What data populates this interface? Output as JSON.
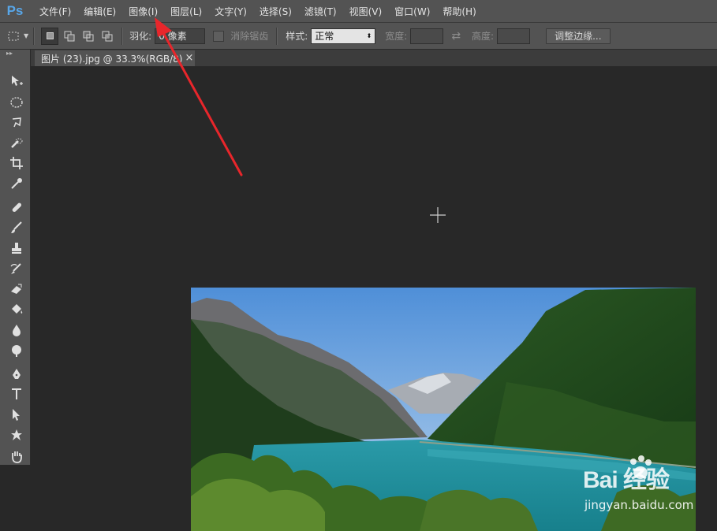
{
  "app": {
    "logo": "Ps"
  },
  "menu": [
    "文件(F)",
    "编辑(E)",
    "图像(I)",
    "图层(L)",
    "文字(Y)",
    "选择(S)",
    "滤镜(T)",
    "视图(V)",
    "窗口(W)",
    "帮助(H)"
  ],
  "options": {
    "feather_label": "羽化:",
    "feather_value": "0 像素",
    "antialias_label": "消除锯齿",
    "style_label": "样式:",
    "style_value": "正常",
    "width_label": "宽度:",
    "height_label": "高度:",
    "refine_edge_button": "调整边缘..."
  },
  "document_tab": {
    "title": "图片 (23).jpg @ 33.3%(RGB/8)",
    "close_glyph": "×"
  },
  "toolbar_icons": [
    "move-icon",
    "elliptical-marquee-icon",
    "lasso-icon",
    "quick-selection-icon",
    "crop-icon",
    "eyedropper-icon",
    "healing-brush-icon",
    "brush-icon",
    "clone-stamp-icon",
    "history-brush-icon",
    "eraser-icon",
    "paint-bucket-icon",
    "blur-icon",
    "dodge-icon",
    "pen-icon",
    "type-icon",
    "path-selection-icon",
    "custom-shape-icon",
    "hand-icon"
  ],
  "watermark": {
    "brand": "Bai 经验",
    "url": "jingyan.baidu.com"
  },
  "colors": {
    "annotation_arrow": "#e8262b",
    "ps_logo": "#58a6e8"
  }
}
